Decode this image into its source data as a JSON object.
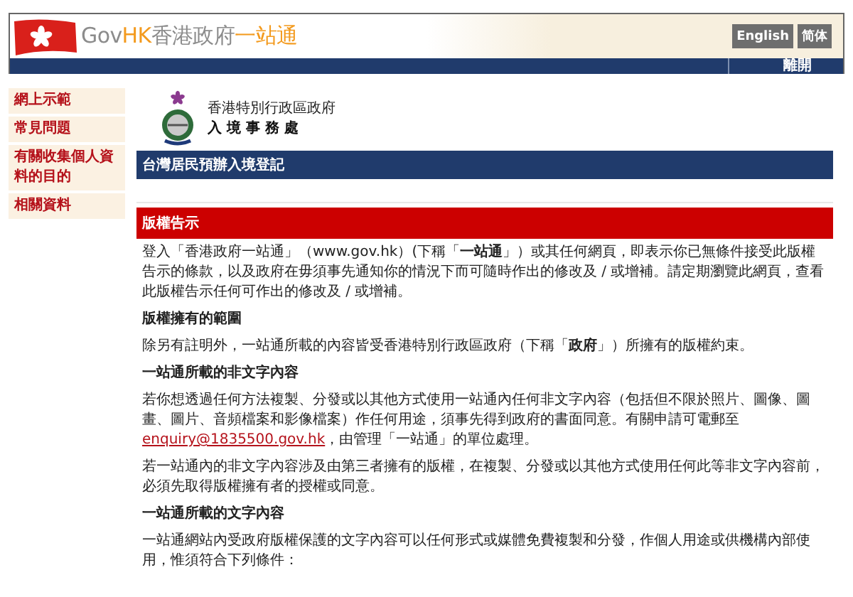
{
  "header": {
    "logo_parts": [
      {
        "text": "Gov",
        "accent": false
      },
      {
        "text": "HK",
        "accent": true
      },
      {
        "text": "香港政府",
        "accent": false
      },
      {
        "text": "一站通",
        "accent": true
      }
    ],
    "languages": [
      "English",
      "简体"
    ],
    "exit": "離開"
  },
  "sidebar": {
    "items": [
      "網上示範",
      "常見問題",
      "有關收集個人資料的目的",
      "相關資料"
    ]
  },
  "department": {
    "line_1": "香港特別行政區政府",
    "line_2": "入 境 事 務 處"
  },
  "page_title": "台灣居民預辦入境登記",
  "section_title": "版權告示",
  "content": [
    {
      "kind": "paragraph",
      "text": "登入「香港政府一站通」（www.gov.hk）(下稱「**一站通**」）或其任何網頁，即表示你已無條件接受此版權告示的條款，以及政府在毋須事先通知你的情況下而可隨時作出的修改及 / 或增補。請定期瀏覽此網頁，查看此版權告示任何可作出的修改及 / 或增補。"
    },
    {
      "kind": "heading",
      "text": "版權擁有的範圍"
    },
    {
      "kind": "paragraph",
      "text": "除另有註明外，一站通所載的內容皆受香港特別行政區政府（下稱「**政府**」）所擁有的版權約束。"
    },
    {
      "kind": "heading",
      "text": "一站通所載的非文字內容"
    },
    {
      "kind": "link_paragraph",
      "before": "若你想透過任何方法複製、分發或以其他方式使用一站通內任何非文字內容（包括但不限於照片、圖像、圖畫、圖片、音頻檔案和影像檔案）作任何用途，須事先得到政府的書面同意。有關申請可電郵至",
      "link": "enquiry@1835500.gov.hk",
      "after": "，由管理「一站通」的單位處理。"
    },
    {
      "kind": "paragraph",
      "text": "若一站通內的非文字內容涉及由第三者擁有的版權，在複製、分發或以其他方式使用任何此等非文字內容前，必須先取得版權擁有者的授權或同意。"
    },
    {
      "kind": "heading",
      "text": "一站通所載的文字內容"
    },
    {
      "kind": "paragraph",
      "text": "一站通網站內受政府版權保護的文字內容可以任何形式或媒體免費複製和分發，作個人用途或供機構內部使用，惟須符合下列條件："
    }
  ]
}
